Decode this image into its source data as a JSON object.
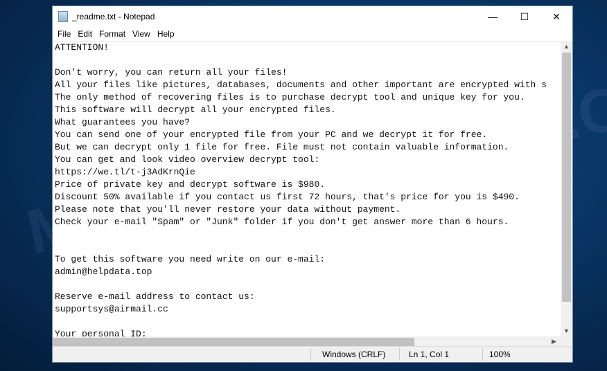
{
  "window": {
    "title": "_readme.txt - Notepad",
    "minimize": "—",
    "maximize": "☐",
    "close": "✕"
  },
  "menu": [
    "File",
    "Edit",
    "Format",
    "View",
    "Help"
  ],
  "content": "ATTENTION!\n\nDon't worry, you can return all your files!\nAll your files like pictures, databases, documents and other important are encrypted with s\nThe only method of recovering files is to purchase decrypt tool and unique key for you.\nThis software will decrypt all your encrypted files.\nWhat guarantees you have?\nYou can send one of your encrypted file from your PC and we decrypt it for free.\nBut we can decrypt only 1 file for free. File must not contain valuable information.\nYou can get and look video overview decrypt tool:\nhttps://we.tl/t-j3AdKrnQie\nPrice of private key and decrypt software is $980.\nDiscount 50% available if you contact us first 72 hours, that's price for you is $490.\nPlease note that you'll never restore your data without payment.\nCheck your e-mail \"Spam\" or \"Junk\" folder if you don't get answer more than 6 hours.\n\n\nTo get this software you need write on our e-mail:\nadmin@helpdata.top\n\nReserve e-mail address to contact us:\nsupportsys@airmail.cc\n\nYour personal ID:",
  "status": {
    "line_ending": "Windows (CRLF)",
    "position": "Ln 1, Col 1",
    "zoom": "100%"
  },
  "watermark": "MYANTISPYWARE.COM"
}
